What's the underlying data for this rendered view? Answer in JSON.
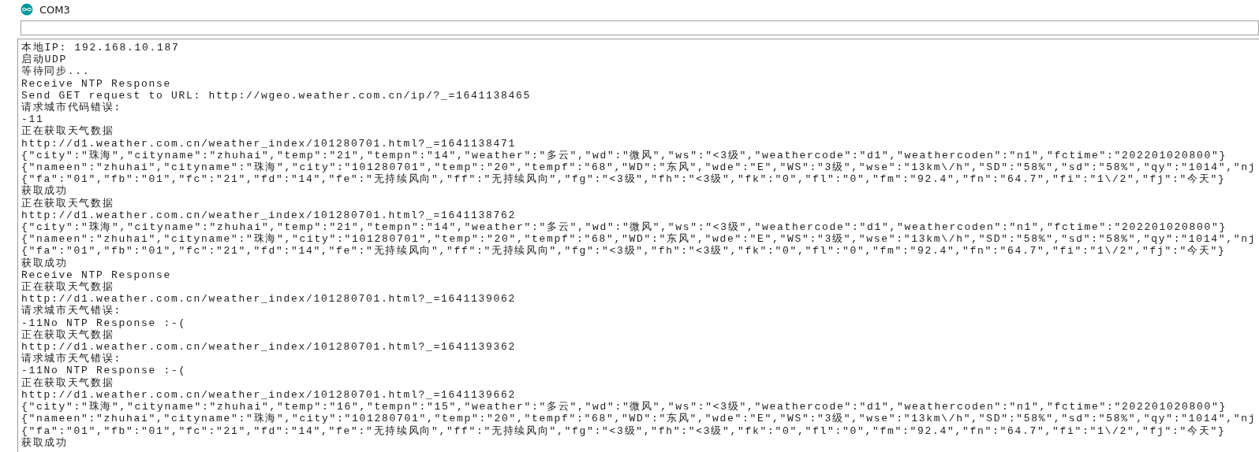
{
  "window": {
    "title": "COM3"
  },
  "output_lines": [
    "本地IP:  192.168.10.187",
    "启动UDP",
    "等待同步...",
    "Receive NTP Response",
    "Send GET request to URL: http://wgeo.weather.com.cn/ip/?_=1641138465",
    "请求城市代码错误:",
    "-11",
    "正在获取天气数据",
    "http://d1.weather.com.cn/weather_index/101280701.html?_=1641138471",
    "{\"city\":\"珠海\",\"cityname\":\"zhuhai\",\"temp\":\"21\",\"tempn\":\"14\",\"weather\":\"多云\",\"wd\":\"微风\",\"ws\":\"<3级\",\"weathercode\":\"d1\",\"weathercoden\":\"n1\",\"fctime\":\"202201020800\"}",
    "{\"nameen\":\"zhuhai\",\"cityname\":\"珠海\",\"city\":\"101280701\",\"temp\":\"20\",\"tempf\":\"68\",\"WD\":\"东风\",\"wde\":\"E\",\"WS\":\"3级\",\"wse\":\"13km\\/h\",\"SD\":\"58%\",\"sd\":\"58%\",\"qy\":\"1014\",\"nj",
    "{\"fa\":\"01\",\"fb\":\"01\",\"fc\":\"21\",\"fd\":\"14\",\"fe\":\"无持续风向\",\"ff\":\"无持续风向\",\"fg\":\"<3级\",\"fh\":\"<3级\",\"fk\":\"0\",\"fl\":\"0\",\"fm\":\"92.4\",\"fn\":\"64.7\",\"fi\":\"1\\/2\",\"fj\":\"今天\"}",
    "获取成功",
    "正在获取天气数据",
    "http://d1.weather.com.cn/weather_index/101280701.html?_=1641138762",
    "{\"city\":\"珠海\",\"cityname\":\"zhuhai\",\"temp\":\"21\",\"tempn\":\"14\",\"weather\":\"多云\",\"wd\":\"微风\",\"ws\":\"<3级\",\"weathercode\":\"d1\",\"weathercoden\":\"n1\",\"fctime\":\"202201020800\"}",
    "{\"nameen\":\"zhuhai\",\"cityname\":\"珠海\",\"city\":\"101280701\",\"temp\":\"20\",\"tempf\":\"68\",\"WD\":\"东风\",\"wde\":\"E\",\"WS\":\"3级\",\"wse\":\"13km\\/h\",\"SD\":\"58%\",\"sd\":\"58%\",\"qy\":\"1014\",\"nj",
    "{\"fa\":\"01\",\"fb\":\"01\",\"fc\":\"21\",\"fd\":\"14\",\"fe\":\"无持续风向\",\"ff\":\"无持续风向\",\"fg\":\"<3级\",\"fh\":\"<3级\",\"fk\":\"0\",\"fl\":\"0\",\"fm\":\"92.4\",\"fn\":\"64.7\",\"fi\":\"1\\/2\",\"fj\":\"今天\"}",
    "获取成功",
    "Receive NTP Response",
    "正在获取天气数据",
    "http://d1.weather.com.cn/weather_index/101280701.html?_=1641139062",
    "请求城市天气错误:",
    "-11No NTP Response :-(",
    "正在获取天气数据",
    "http://d1.weather.com.cn/weather_index/101280701.html?_=1641139362",
    "请求城市天气错误:",
    "-11No NTP Response :-(",
    "正在获取天气数据",
    "http://d1.weather.com.cn/weather_index/101280701.html?_=1641139662",
    "{\"city\":\"珠海\",\"cityname\":\"zhuhai\",\"temp\":\"16\",\"tempn\":\"15\",\"weather\":\"多云\",\"wd\":\"微风\",\"ws\":\"<3级\",\"weathercode\":\"d1\",\"weathercoden\":\"n1\",\"fctime\":\"202201020800\"}",
    "{\"nameen\":\"zhuhai\",\"cityname\":\"珠海\",\"city\":\"101280701\",\"temp\":\"20\",\"tempf\":\"68\",\"WD\":\"东风\",\"wde\":\"E\",\"WS\":\"3级\",\"wse\":\"13km\\/h\",\"SD\":\"58%\",\"sd\":\"58%\",\"qy\":\"1014\",\"nj",
    "{\"fa\":\"01\",\"fb\":\"01\",\"fc\":\"21\",\"fd\":\"14\",\"fe\":\"无持续风向\",\"ff\":\"无持续风向\",\"fg\":\"<3级\",\"fh\":\"<3级\",\"fk\":\"0\",\"fl\":\"0\",\"fm\":\"92.4\",\"fn\":\"64.7\",\"fi\":\"1\\/2\",\"fj\":\"今天\"}",
    "获取成功"
  ]
}
